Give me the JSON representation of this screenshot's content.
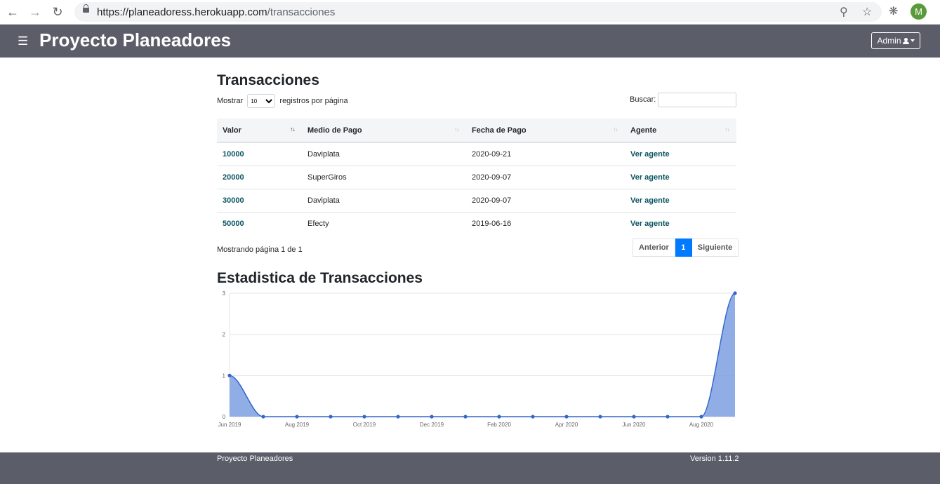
{
  "browser": {
    "url_host": "https://planeadoress.herokuapp.com",
    "url_path": "/transacciones",
    "profile_initial": "M"
  },
  "navbar": {
    "brand": "Proyecto Planeadores",
    "admin_label": "Admin"
  },
  "page": {
    "title": "Transacciones",
    "length_prefix": "Mostrar",
    "length_value": "10",
    "length_suffix": "registros por página",
    "search_label": "Buscar:"
  },
  "table": {
    "columns": [
      "Valor",
      "Medio de Pago",
      "Fecha de Pago",
      "Agente"
    ],
    "rows": [
      {
        "valor": "10000",
        "medio": "Daviplata",
        "fecha": "2020-09-21",
        "agente": "Ver agente"
      },
      {
        "valor": "20000",
        "medio": "SuperGiros",
        "fecha": "2020-09-07",
        "agente": "Ver agente"
      },
      {
        "valor": "30000",
        "medio": "Daviplata",
        "fecha": "2020-09-07",
        "agente": "Ver agente"
      },
      {
        "valor": "50000",
        "medio": "Efecty",
        "fecha": "2019-06-16",
        "agente": "Ver agente"
      }
    ]
  },
  "pagination": {
    "info": "Mostrando página 1 de 1",
    "prev": "Anterior",
    "current": "1",
    "next": "Siguiente"
  },
  "stats_title": "Estadistica de Transacciones",
  "chart_data": {
    "type": "area",
    "x": [
      "2019-06",
      "2019-07",
      "2019-08",
      "2019-09",
      "2019-10",
      "2019-11",
      "2019-12",
      "2020-01",
      "2020-02",
      "2020-03",
      "2020-04",
      "2020-05",
      "2020-06",
      "2020-07",
      "2020-08",
      "2020-09"
    ],
    "x_tick_labels": [
      "Jun 2019",
      "Aug 2019",
      "Oct 2019",
      "Dec 2019",
      "Feb 2020",
      "Apr 2020",
      "Jun 2020",
      "Aug 2020"
    ],
    "series": [
      {
        "values": [
          1,
          0,
          0,
          0,
          0,
          0,
          0,
          0,
          0,
          0,
          0,
          0,
          0,
          0,
          0,
          3
        ]
      }
    ],
    "y_ticks": [
      "0",
      "1",
      "2",
      "3"
    ],
    "ylim": [
      0,
      3
    ],
    "grid": true,
    "color": "#3366cc",
    "fill_color": "#7e9fe0"
  },
  "footer": {
    "left": "Proyecto Planeadores",
    "right": "Version 1.11.2"
  }
}
